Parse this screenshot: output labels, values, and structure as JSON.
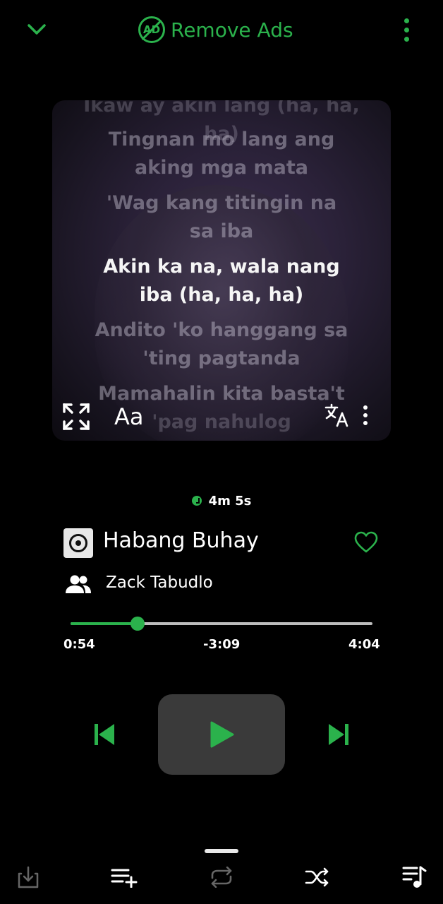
{
  "header": {
    "remove_ads_label": "Remove Ads",
    "ad_badge_text": "AD",
    "accent_color": "#2bb24c"
  },
  "lyrics": {
    "lines": [
      "Tingnan mo lang ang",
      "aking mga mata",
      "'Wag kang titingin na",
      "sa iba",
      "Akin ka na, wala nang",
      "iba (ha, ha, ha)",
      "Andito 'ko hanggang sa",
      "'ting pagtanda",
      "Mamahalin kita basta't",
      "'pag nahulog"
    ],
    "partial_top_line": "Ikaw ay akin lang (ha, ha, ha)",
    "font_button_label": "Aa"
  },
  "sleep_timer": {
    "label": "4m 5s"
  },
  "track": {
    "title": "Habang Buhay",
    "artist": "Zack Tabudlo"
  },
  "progress": {
    "elapsed": "0:54",
    "remaining": "-3:09",
    "total": "4:04",
    "fraction": 0.2213
  },
  "icons": {
    "collapse": "chevron-down-icon",
    "more": "more-vertical-icon",
    "expand": "expand-icon",
    "translate": "translate-icon",
    "favorite": "heart-icon",
    "artist": "people-icon",
    "previous": "skip-previous-icon",
    "play": "play-icon",
    "next": "skip-next-icon",
    "download": "download-icon",
    "add_to_queue": "playlist-add-icon",
    "repeat": "repeat-icon",
    "shuffle": "shuffle-icon",
    "queue": "queue-music-icon"
  }
}
